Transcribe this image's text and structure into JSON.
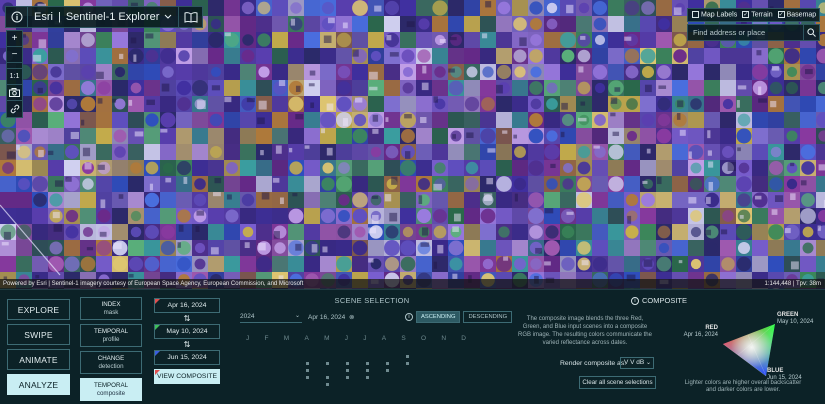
{
  "app": {
    "brand": "Esri",
    "title": "Sentinel-1 Explorer"
  },
  "map_controls": {
    "icons": [
      "plus-icon",
      "minus-icon",
      "one-to-one-icon",
      "camera-icon",
      "link-icon"
    ],
    "zoom_in": "+",
    "zoom_out": "−",
    "scale_label": "1:1"
  },
  "layers": {
    "map_labels": {
      "label": "Map Labels",
      "checked": false
    },
    "terrain": {
      "label": "Terrain",
      "checked": true
    },
    "basemap": {
      "label": "Basemap",
      "checked": true
    }
  },
  "search": {
    "placeholder": "Find address or place"
  },
  "attribution": {
    "left": "Powered by Esri | Sentinel-1 imagery courtesy of European Space Agency, European Commission, and Microsoft",
    "right": "1:144,448 | Tpv: 38m"
  },
  "modes": [
    {
      "label": "EXPLORE",
      "active": false
    },
    {
      "label": "SWIPE",
      "active": false
    },
    {
      "label": "ANIMATE",
      "active": false
    },
    {
      "label": "ANALYZE",
      "active": true
    }
  ],
  "tools": [
    {
      "label": "INDEX",
      "sub": "mask",
      "active": false
    },
    {
      "label": "TEMPORAL",
      "sub": "profile",
      "active": false
    },
    {
      "label": "CHANGE",
      "sub": "detection",
      "active": false
    },
    {
      "label": "TEMPORAL",
      "sub": "composite",
      "active": true
    }
  ],
  "composite_dates": {
    "red": {
      "date": "Apr 16, 2024",
      "color": "#e05050"
    },
    "green": {
      "date": "May 10, 2024",
      "color": "#3fbf5a"
    },
    "blue": {
      "date": "Jun 15, 2024",
      "color": "#3a5ee0"
    },
    "arrow": "⇅",
    "view_button": "VIEW COMPOSITE"
  },
  "scene_selection": {
    "title": "SCENE SELECTION",
    "year": "2024",
    "selected_date": "Apr 16, 2024",
    "ascending": "ASCENDING",
    "descending": "DESCENDING",
    "months": [
      "J",
      "F",
      "M",
      "A",
      "M",
      "J",
      "J",
      "A",
      "S",
      "O",
      "N",
      "D"
    ]
  },
  "composite": {
    "title": "COMPOSITE",
    "description": "The composite image blends the three Red, Green, and Blue input scenes into a composite RGB image. The resulting colors communicate the varied reflectance across dates.",
    "render_label": "Render composite as:",
    "render_value": "V V dB",
    "clear_button": "Clear all scene selections",
    "red": {
      "name": "RED",
      "date": "Apr 16, 2024"
    },
    "green": {
      "name": "GREEN",
      "date": "May 10, 2024"
    },
    "blue": {
      "name": "BLUE",
      "date": "Jun 15, 2024"
    },
    "footnote": "Lighter colors are higher overall backscatter and darker colors are lower."
  }
}
